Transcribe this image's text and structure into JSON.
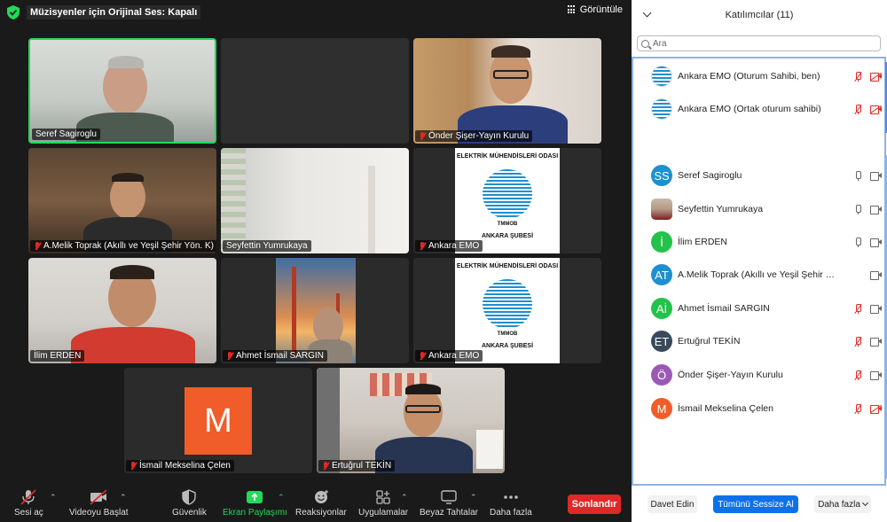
{
  "meeting": {
    "original_sound": "Müzisyenler için Orijinal Ses: Kapalı",
    "view_label": "Görüntüle",
    "tiles": [
      {
        "name": "Seref Sagiroglu",
        "muted": false,
        "active": true
      },
      {
        "name": "",
        "muted": false,
        "active": false
      },
      {
        "name": "Önder Şişer-Yayın Kurulu",
        "muted": true,
        "active": false
      },
      {
        "name": "A.Melik Toprak (Akıllı ve Yeşil Şehir Yön. K)",
        "muted": true,
        "active": false
      },
      {
        "name": "Seyfettin Yumrukaya",
        "muted": false,
        "active": false
      },
      {
        "name": "Ankara EMO",
        "muted": true,
        "active": false
      },
      {
        "name": "İlim ERDEN",
        "muted": false,
        "active": false
      },
      {
        "name": "Ahmet İsmail SARGIN",
        "muted": true,
        "active": false
      },
      {
        "name": "Ankara EMO",
        "muted": true,
        "active": false
      },
      {
        "name": "İsmail Mekselina Çelen",
        "muted": true,
        "active": false
      },
      {
        "name": "Ertuğrul TEKİN",
        "muted": true,
        "active": false
      }
    ],
    "emo_logo_text": {
      "top": "ELEKTRİK MÜHENDİSLERİ ODASI",
      "bottom": "ANKARA ŞUBESİ",
      "badge": "TMMOB"
    },
    "m_avatar_letter": "M"
  },
  "toolbar": {
    "unmute": "Sesi aç",
    "start_video": "Videoyu Başlat",
    "security": "Güvenlik",
    "share_screen": "Ekran Paylaşımı",
    "reactions": "Reaksiyonlar",
    "apps": "Uygulamalar",
    "whiteboards": "Beyaz Tahtalar",
    "more": "Daha fazla",
    "end": "Sonlandır",
    "share_color": "#23d959",
    "end_color": "#e02828"
  },
  "panel": {
    "title": "Katılımcılar (11)",
    "search_placeholder": "Ara",
    "participants": [
      {
        "initials": "",
        "name": "Ankara EMO (Oturum Sahibi, ben)",
        "avatar": "emo-logo",
        "mic": "off",
        "cam": "off"
      },
      {
        "initials": "",
        "name": "Ankara EMO (Ortak oturum sahibi)",
        "avatar": "emo-logo",
        "mic": "off",
        "cam": "off"
      },
      {
        "initials": "SS",
        "name": "Seref Sagiroglu",
        "avatar_color": "#1d8fd0",
        "mic": "on",
        "cam": "on"
      },
      {
        "initials": "",
        "name": "Seyfettin Yumrukaya",
        "avatar": "photo",
        "mic": "on",
        "cam": "on"
      },
      {
        "initials": "İ",
        "name": "İlim ERDEN",
        "avatar_color": "#23c24a",
        "mic": "on",
        "cam": "on"
      },
      {
        "initials": "AT",
        "name": "A.Melik Toprak (Akıllı ve Yeşil Şehir Y...",
        "avatar_color": "#1d8fd0",
        "mic": "off",
        "cam": "on"
      },
      {
        "initials": "Aİ",
        "name": "Ahmet İsmail SARGIN",
        "avatar_color": "#23c24a",
        "mic": "off",
        "cam": "on"
      },
      {
        "initials": "ET",
        "name": "Ertuğrul TEKİN",
        "avatar_color": "#3a4a5c",
        "mic": "off",
        "cam": "on"
      },
      {
        "initials": "Ö",
        "name": "Önder Şişer-Yayın Kurulu",
        "avatar_color": "#9b59b6",
        "mic": "off",
        "cam": "on"
      },
      {
        "initials": "M",
        "name": "İsmail Mekselina Çelen",
        "avatar_color": "#f05c2a",
        "mic": "off",
        "cam": "off"
      }
    ],
    "invite": "Davet Edin",
    "mute_all": "Tümünü Sessize Al",
    "more": "Daha fazla"
  }
}
